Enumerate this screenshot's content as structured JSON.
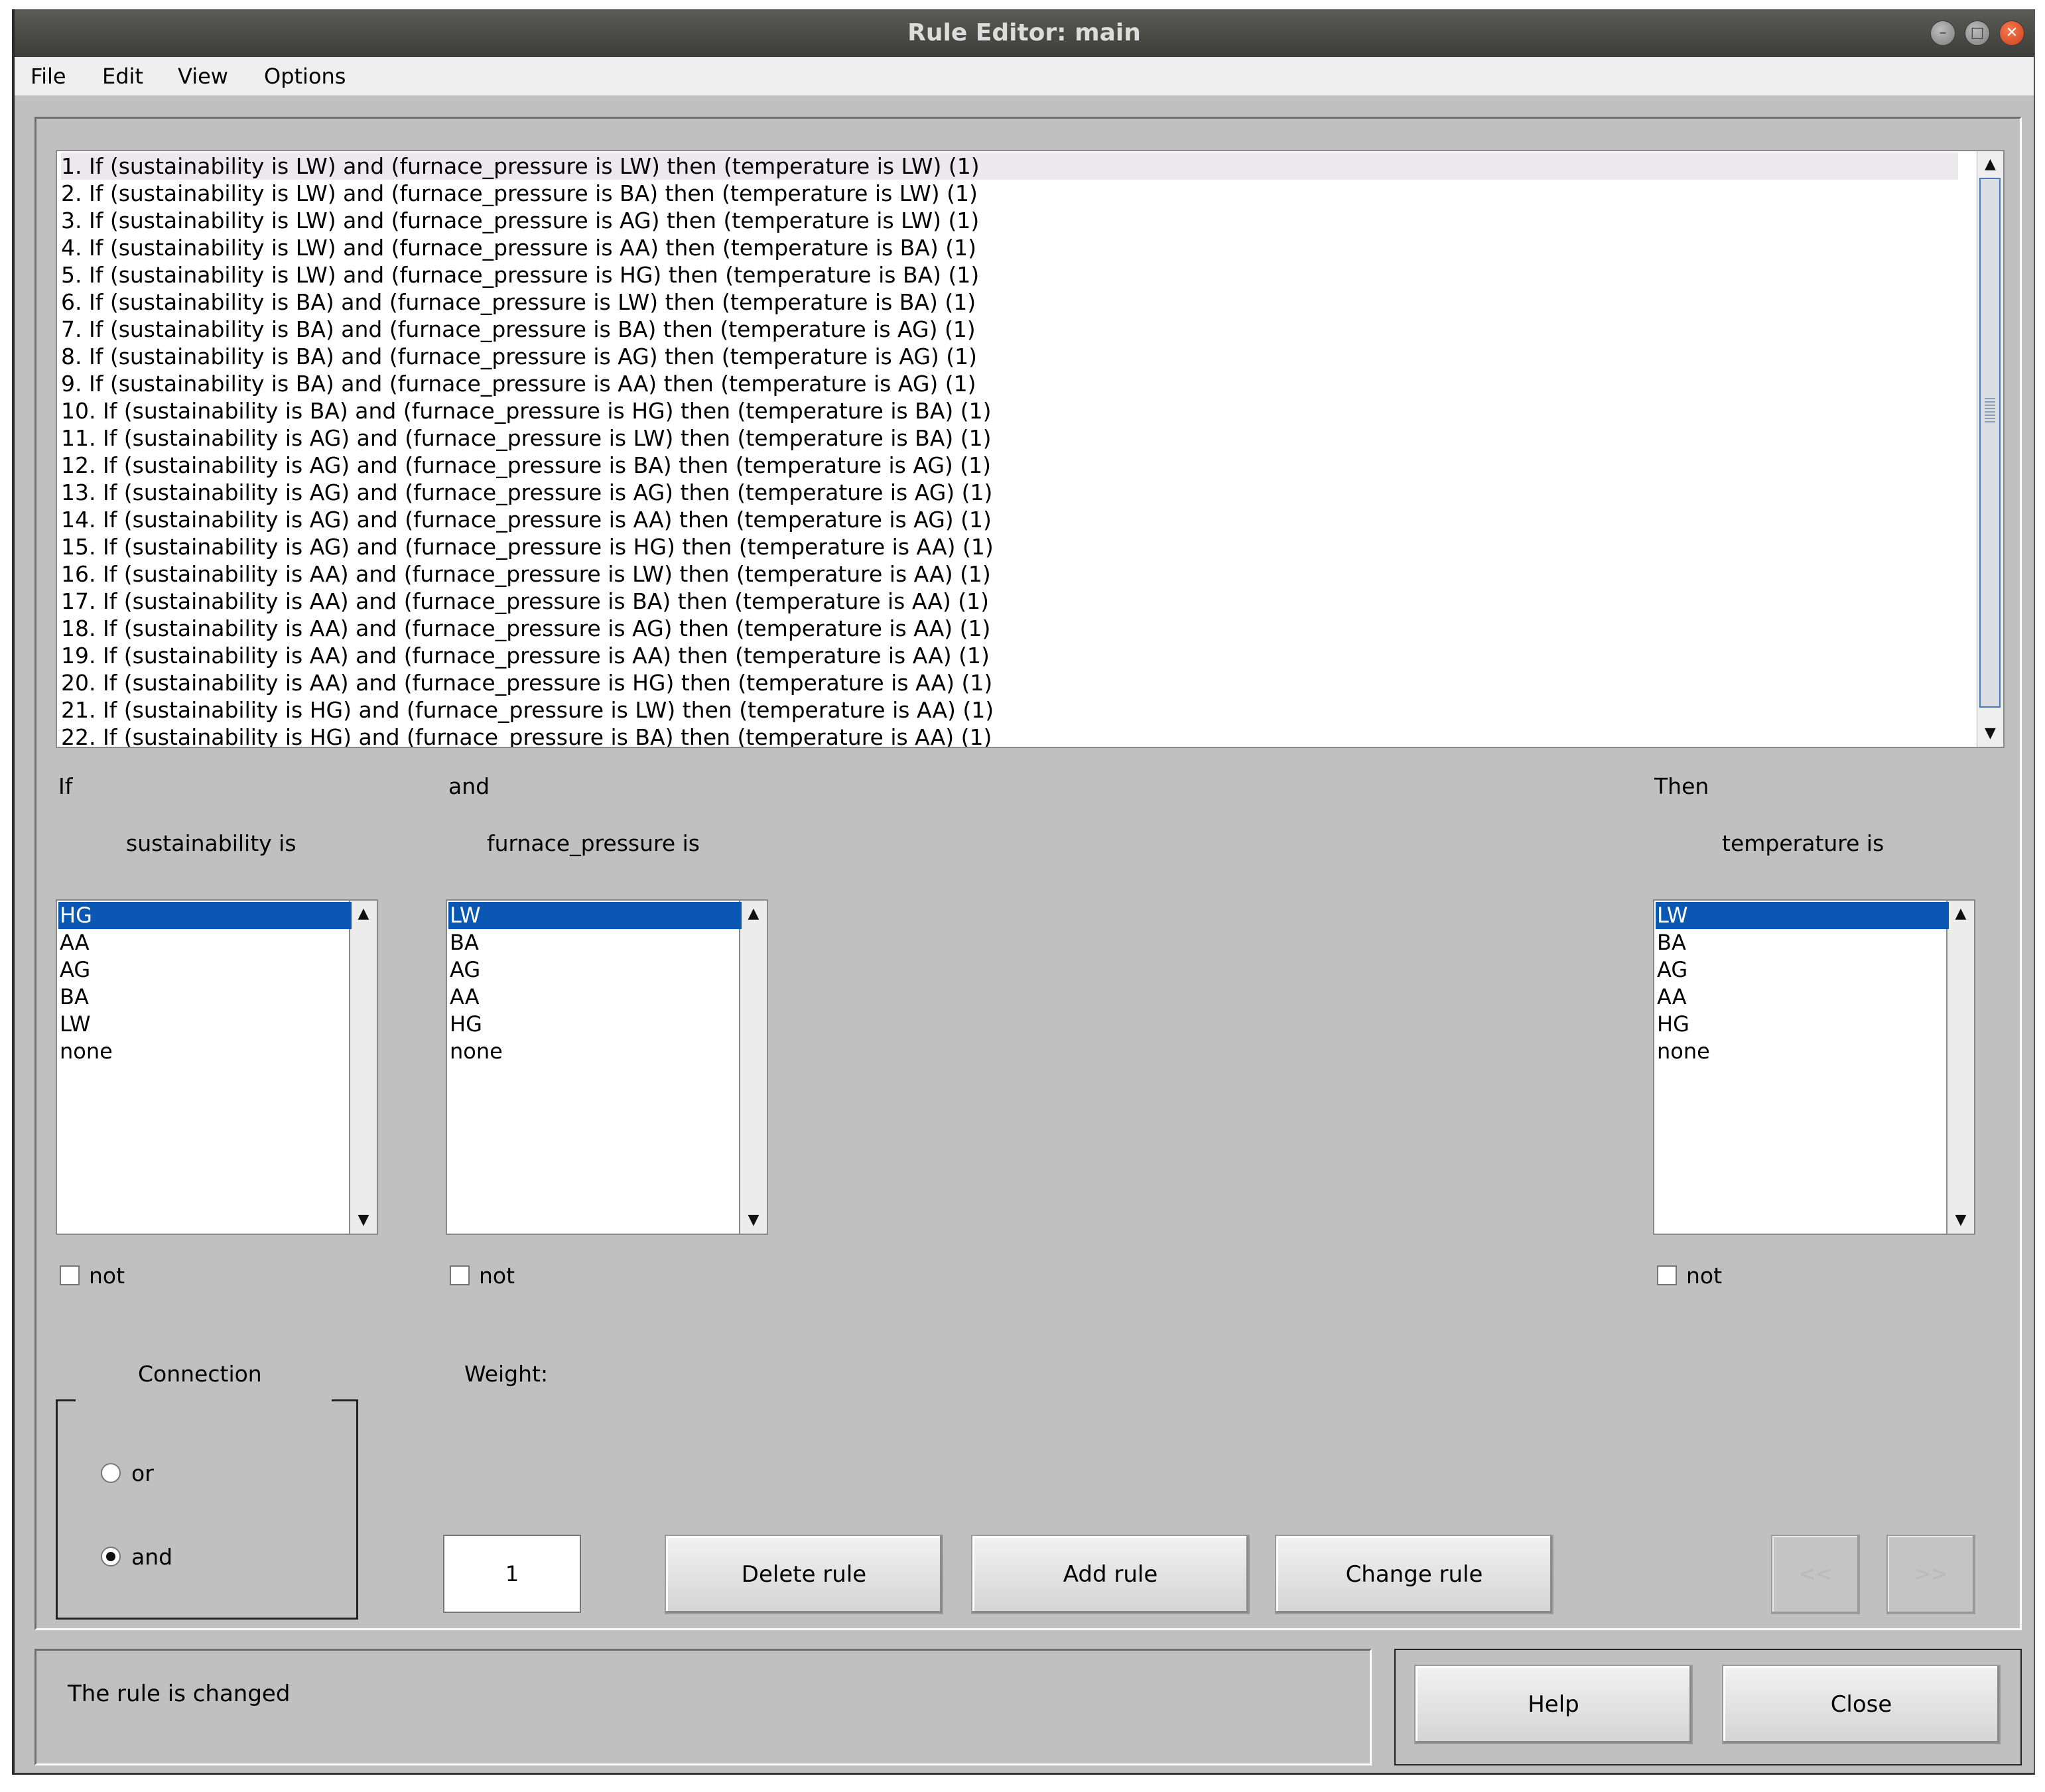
{
  "window": {
    "title": "Rule Editor: main"
  },
  "menu": [
    "File",
    "Edit",
    "View",
    "Options"
  ],
  "rules": [
    "1. If (sustainability is LW) and (furnace_pressure is LW) then (temperature is LW) (1)",
    "2. If (sustainability is LW) and (furnace_pressure is BA) then (temperature is LW) (1)",
    "3. If (sustainability is LW) and (furnace_pressure is AG) then (temperature is LW) (1)",
    "4. If (sustainability is LW) and (furnace_pressure is AA) then (temperature is BA) (1)",
    "5. If (sustainability is LW) and (furnace_pressure is HG) then (temperature is BA) (1)",
    "6. If (sustainability is BA) and (furnace_pressure is LW) then (temperature is BA) (1)",
    "7. If (sustainability is BA) and (furnace_pressure is BA) then (temperature is AG) (1)",
    "8. If (sustainability is BA) and (furnace_pressure is AG) then (temperature is AG) (1)",
    "9. If (sustainability is BA) and (furnace_pressure is AA) then (temperature is AG) (1)",
    "10. If (sustainability is BA) and (furnace_pressure is HG) then (temperature is BA) (1)",
    "11. If (sustainability is AG) and (furnace_pressure is LW) then (temperature is BA) (1)",
    "12. If (sustainability is AG) and (furnace_pressure is BA) then (temperature is AG) (1)",
    "13. If (sustainability is AG) and (furnace_pressure is AG) then (temperature is AG) (1)",
    "14. If (sustainability is AG) and (furnace_pressure is AA) then (temperature is AG) (1)",
    "15. If (sustainability is AG) and (furnace_pressure is HG) then (temperature is AA) (1)",
    "16. If (sustainability is AA) and (furnace_pressure is LW) then (temperature is AA) (1)",
    "17. If (sustainability is AA) and (furnace_pressure is BA) then (temperature is AA) (1)",
    "18. If (sustainability is AA) and (furnace_pressure is AG) then (temperature is AA) (1)",
    "19. If (sustainability is AA) and (furnace_pressure is AA) then (temperature is AA) (1)",
    "20. If (sustainability is AA) and (furnace_pressure is HG) then (temperature is AA) (1)",
    "21. If (sustainability is HG) and (furnace_pressure is LW) then (temperature is AA) (1)",
    "22. If (sustainability is HG) and (furnace_pressure is BA) then (temperature is AA) (1)"
  ],
  "selected_rule_index": 0,
  "rule_list_scroll_fraction": 0.2,
  "labels": {
    "if": "If",
    "and": "and",
    "then": "Then",
    "not": "not",
    "connection": "Connection",
    "weight": "Weight:"
  },
  "inputs": [
    {
      "label": "sustainability is",
      "options": [
        "HG",
        "AA",
        "AG",
        "BA",
        "LW",
        "none"
      ],
      "selected": "HG",
      "not_checked": false
    },
    {
      "label": "furnace_pressure is",
      "options": [
        "LW",
        "BA",
        "AG",
        "AA",
        "HG",
        "none"
      ],
      "selected": "LW",
      "not_checked": false
    }
  ],
  "output": {
    "label": "temperature is",
    "options": [
      "LW",
      "BA",
      "AG",
      "AA",
      "HG",
      "none"
    ],
    "selected": "LW",
    "not_checked": false
  },
  "connection": {
    "options": [
      "or",
      "and"
    ],
    "selected": "and"
  },
  "weight_value": "1",
  "buttons": {
    "delete_rule": "Delete rule",
    "add_rule": "Add rule",
    "change_rule": "Change rule",
    "prev": "<<",
    "next": ">>",
    "help": "Help",
    "close": "Close"
  },
  "status_text": "The rule is changed"
}
